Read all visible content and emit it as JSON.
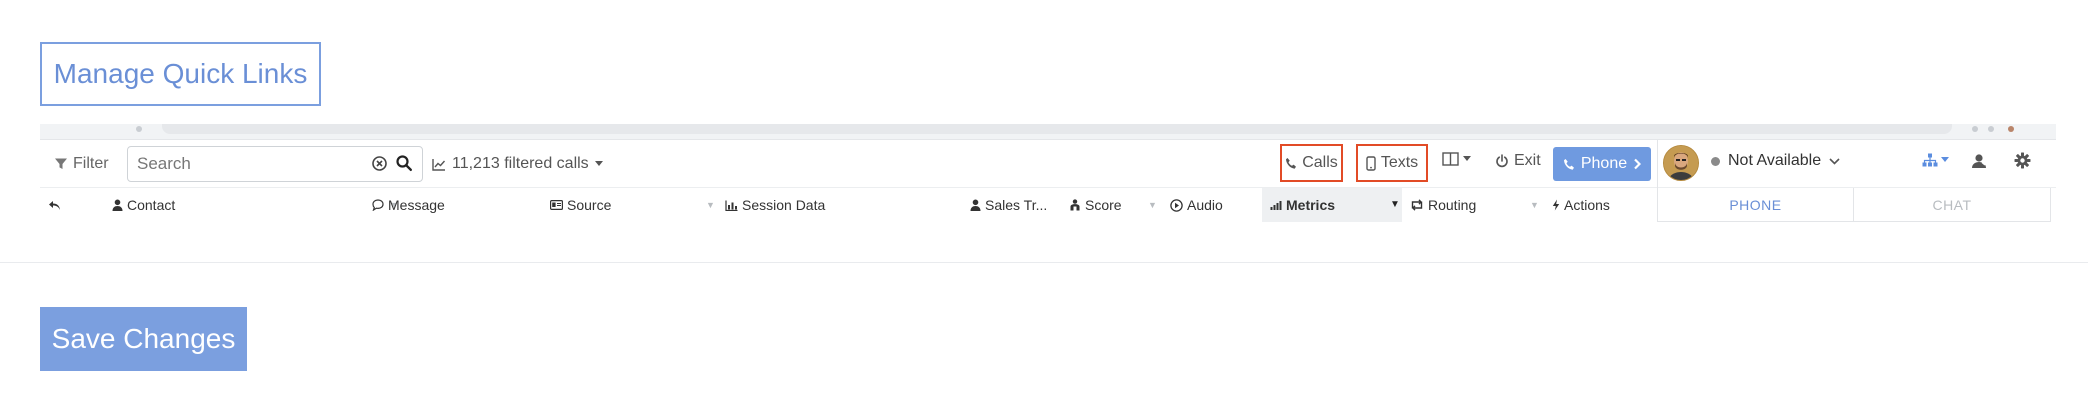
{
  "manage_quick_links_label": "Manage Quick Links",
  "save_changes_label": "Save Changes",
  "toolbar": {
    "filter_label": "Filter",
    "search_placeholder": "Search",
    "filtered_calls_label": "11,213 filtered calls",
    "calls_label": "Calls",
    "texts_label": "Texts",
    "exit_label": "Exit",
    "phone_label": "Phone",
    "status_label": "Not Available"
  },
  "columns": [
    {
      "label": "Contact",
      "icon": "user-icon"
    },
    {
      "label": "Message",
      "icon": "speech-bubble-icon"
    },
    {
      "label": "Source",
      "icon": "id-card-icon"
    },
    {
      "label": "Session Data",
      "icon": "chart-icon"
    },
    {
      "label": "Sales Tr...",
      "icon": "user-icon"
    },
    {
      "label": "Score",
      "icon": "score-icon"
    },
    {
      "label": "Audio",
      "icon": "play-circle-icon"
    },
    {
      "label": "Metrics",
      "icon": "signal-bars-icon"
    },
    {
      "label": "Routing",
      "icon": "retweet-icon"
    },
    {
      "label": "Actions",
      "icon": "bolt-icon"
    }
  ],
  "side_tabs": [
    {
      "label": "PHONE",
      "active": true
    },
    {
      "label": "CHAT",
      "active": false
    }
  ],
  "colors": {
    "accent": "#7b9fdf",
    "highlight_border": "#e24b26",
    "phone_button": "#6f9ae0"
  }
}
